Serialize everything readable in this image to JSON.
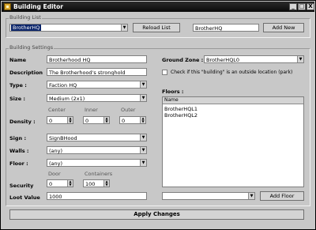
{
  "window": {
    "title": "Building Editor",
    "minimize": "_",
    "maximize": "□",
    "close": "X"
  },
  "building_list": {
    "group_title": "Building List",
    "selected_building": "BrotherHQ",
    "reload_label": "Reload List",
    "new_name_value": "BrotherHQ",
    "add_new_label": "Add New"
  },
  "settings": {
    "group_title": "Building Settings",
    "name_label": "Name",
    "name_value": "Brotherhood HQ",
    "description_label": "Description",
    "description_value": "The Brotherhood's stronghold",
    "type_label": "Type :",
    "type_value": "Faction HQ",
    "size_label": "Size :",
    "size_value": "Medium (2x1)",
    "density_label": "Density :",
    "density_headers": {
      "center": "Center",
      "inner": "Inner",
      "outer": "Outer"
    },
    "density_values": {
      "center": "0",
      "inner": "0",
      "outer": "0"
    },
    "sign_label": "Sign :",
    "sign_value": "SignBHood",
    "walls_label": "Walls :",
    "walls_value": "(any)",
    "floor_label": "Floor :",
    "floor_value": "(any)",
    "security_label": "Security",
    "security_headers": {
      "door": "Door",
      "containers": "Containers"
    },
    "security_values": {
      "door": "0",
      "containers": "100"
    },
    "loot_label": "Loot Value",
    "loot_value": "1000",
    "ground_zone_label": "Ground Zone :",
    "ground_zone_value": "BrotherHQL0",
    "outside_check_label": "Check if this \"building\" is an outside location (park)",
    "outside_checked": false,
    "floors_label": "Floors :",
    "floors_header": "Name",
    "floors": [
      "BrotherHQL1",
      "BrotherHQL2"
    ],
    "floor_select_value": "",
    "add_floor_label": "Add Floor"
  },
  "apply_label": "Apply Changes"
}
